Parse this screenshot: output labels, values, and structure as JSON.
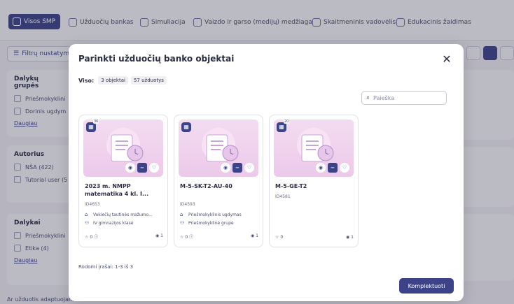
{
  "topnav": {
    "tabs": [
      {
        "label": "Visos SMP",
        "icon": "grid-icon"
      },
      {
        "label": "Užduočių bankas",
        "icon": "bank-icon"
      },
      {
        "label": "Simuliacija",
        "icon": "simulation-icon"
      },
      {
        "label": "Vaizdo ir garso (medijų) medžiaga",
        "icon": "media-icon"
      },
      {
        "label": "Skaitmeninis vadovėlis",
        "icon": "book-icon"
      },
      {
        "label": "Edukacinis žaidimas",
        "icon": "game-icon"
      }
    ]
  },
  "filters": {
    "button_label": "Filtrų nustatym",
    "groups": [
      {
        "title": "Dalykų grupės",
        "items": [
          "Priešmokyklini",
          "Dorinis ugdym"
        ],
        "more": "Daugiau"
      },
      {
        "title": "Autorius",
        "items": [
          "NŠA (422)",
          "Tutorial user (5"
        ],
        "more": ""
      },
      {
        "title": "Dalykai",
        "items": [
          "Priešmokyklini",
          "Etika (4)"
        ],
        "more": "Daugiau"
      }
    ],
    "bottom_label": "Ar užduotis adaptuojama"
  },
  "modal": {
    "title": "Parinkti užduočių banko objektai",
    "summary_label": "Viso:",
    "count_objects": "3 objektai",
    "count_tasks": "57 užduotys",
    "search_placeholder": "Paieška",
    "shown_text": "Rodomi įrašai: 1-3 iš 3",
    "complete_label": "Komplektuoti",
    "cards": [
      {
        "badge": "36",
        "name": "2023 m. NMPP matematika 4 kl. I...",
        "id": "ID4653",
        "meta": [
          {
            "icon": "graduation-icon",
            "text": "Vokiečių tautinės mažumo..."
          },
          {
            "icon": "users-icon",
            "text": "IV gimnazijos klasė"
          }
        ],
        "stars": "0",
        "views": "1"
      },
      {
        "badge": "",
        "name": "M-5-SK-T2-AU-40",
        "id": "ID4593",
        "meta": [
          {
            "icon": "graduation-icon",
            "text": "Priešmokyklinis ugdymas"
          },
          {
            "icon": "users-icon",
            "text": "Priešmokyklinė grupė"
          }
        ],
        "stars": "0",
        "views": "1"
      },
      {
        "badge": "20",
        "name": "M-5-GE-T2",
        "id": "ID4581",
        "meta": [],
        "stars": "0",
        "views": "1"
      }
    ]
  },
  "colors": {
    "primary": "#3d4389",
    "card_bg": "#ecc9ea"
  }
}
